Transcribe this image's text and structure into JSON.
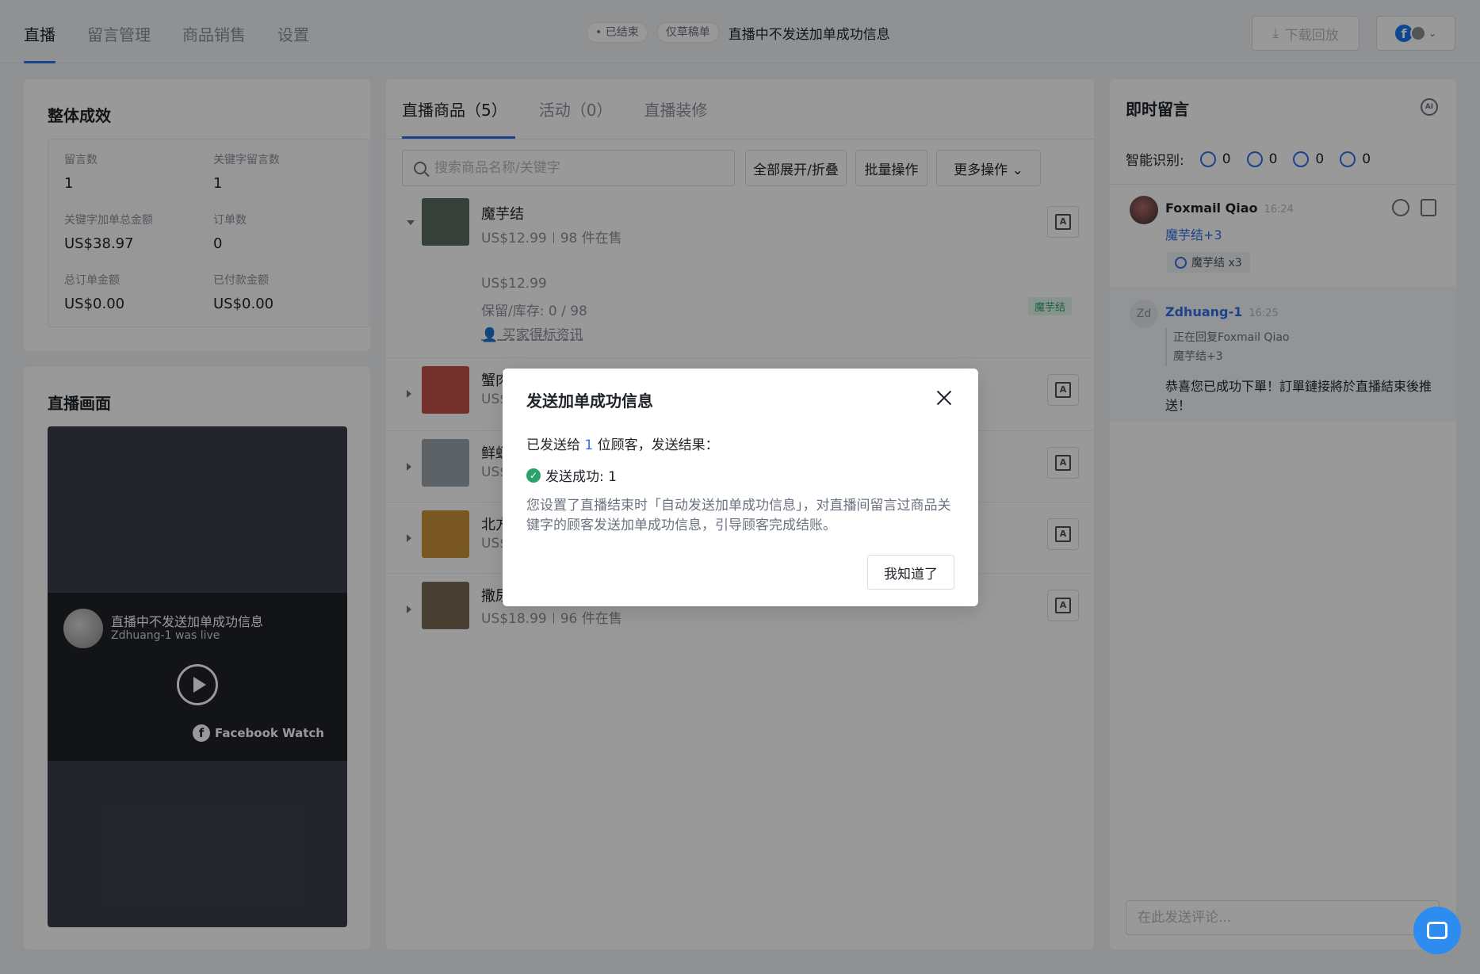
{
  "nav": {
    "tabs": [
      "直播",
      "留言管理",
      "商品销售",
      "设置"
    ]
  },
  "header": {
    "status_chip": "• 已结束",
    "draft_chip": "仅草稿单",
    "live_title": "直播中不发送加单成功信息",
    "download_label": "下载回放"
  },
  "performance": {
    "title": "整体成效",
    "stats": [
      {
        "label": "留言数",
        "value": "1"
      },
      {
        "label": "关键字留言数",
        "value": "1"
      },
      {
        "label": "关键字加单总金额",
        "value": "US$38.97"
      },
      {
        "label": "订单数",
        "value": "0"
      },
      {
        "label": "总订单金额",
        "value": "US$0.00"
      },
      {
        "label": "已付款金额",
        "value": "US$0.00"
      }
    ]
  },
  "screen": {
    "title": "直播画面",
    "video_title": "直播中不发送加单成功信息",
    "video_sub": "Zdhuang-1 was live",
    "brand": "Facebook Watch"
  },
  "products": {
    "tabs": [
      "直播商品（5）",
      "活动（0）",
      "直播装修"
    ],
    "search_placeholder": "搜索商品名称/关键字",
    "btn_expand": "全部展开/折叠",
    "btn_batch": "批量操作",
    "btn_more": "更多操作 ⌄",
    "items": [
      {
        "name": "魔芋结",
        "price": "US$12.99",
        "stock": "98 件在售",
        "color": "#5c6b5e"
      },
      {
        "name": "蟹肉",
        "price": "US$",
        "stock": "",
        "color": "#c0504a"
      },
      {
        "name": "鲜虾",
        "price": "US$",
        "stock": "",
        "color": "#9aa3ab"
      },
      {
        "name": "北方",
        "price": "US$",
        "stock": "",
        "color": "#c8923a"
      },
      {
        "name": "撒尿",
        "price": "US$18.99",
        "stock": "96 件在售",
        "color": "#7a6a55"
      }
    ],
    "sku": {
      "price": "US$12.99",
      "reserve": "保留/库存: 0 / 98",
      "buyer_info": "买家得标资讯",
      "keyword_tag": "魔芋结"
    }
  },
  "comments": {
    "title": "即时留言",
    "smart_label": "智能识别:",
    "counts": [
      "0",
      "0",
      "0",
      "0"
    ],
    "c1": {
      "name": "Foxmail Qiao",
      "time": "16:24",
      "text": "魔芋结+3",
      "order": "魔芋结 x3"
    },
    "c2": {
      "avatar": "Zd",
      "name": "Zdhuang-1",
      "time": "16:25",
      "reply_to": "正在回复Foxmail Qiao",
      "quote": "魔芋结+3",
      "message": "恭喜您已成功下單！訂單鏈接將於直播結束後推送！"
    },
    "input_placeholder": "在此发送评论..."
  },
  "modal": {
    "title": "发送加单成功信息",
    "sent_prefix": "已发送给 ",
    "sent_count": "1",
    "sent_suffix": " 位顾客，发送结果：",
    "success_label": "发送成功: 1",
    "desc": "您设置了直播结束时「自动发送加单成功信息」，对直播间留言过商品关键字的顾客发送加单成功信息，引导顾客完成结账。",
    "ok_label": "我知道了"
  }
}
